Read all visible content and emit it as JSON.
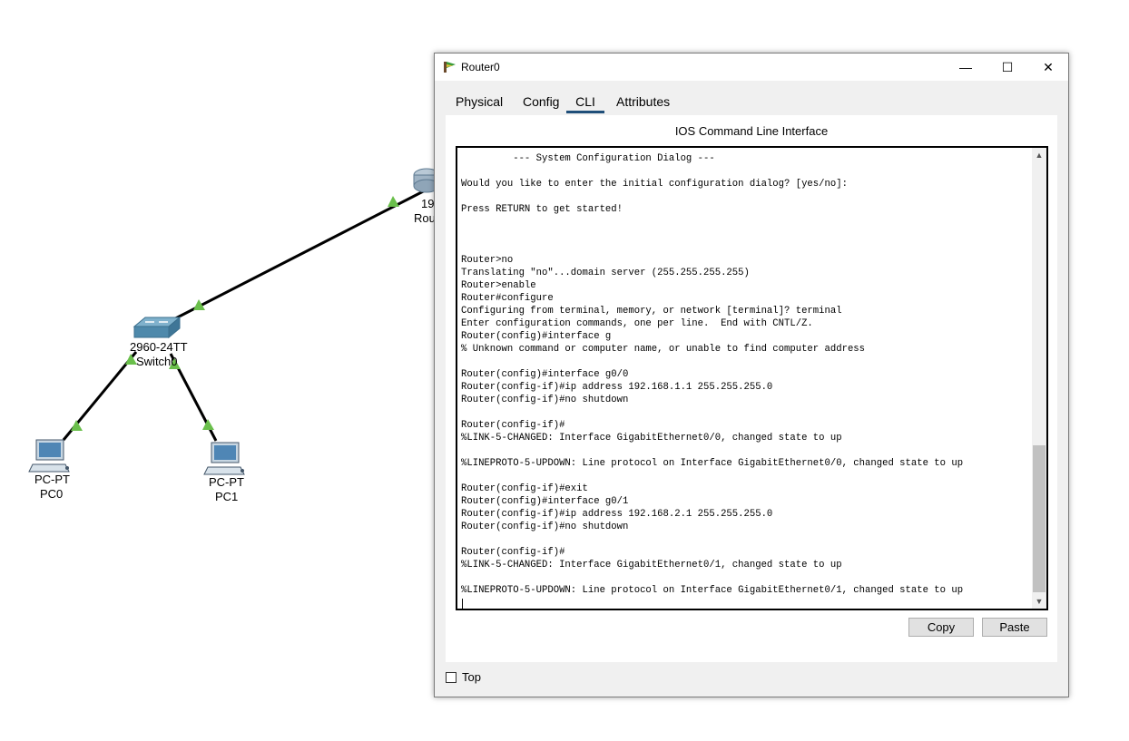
{
  "topology": {
    "devices": [
      {
        "id": "router0",
        "model_label": "19",
        "name_label": "Rou"
      },
      {
        "id": "switch0",
        "model_label": "2960-24TT",
        "name_label": "Switch0"
      },
      {
        "id": "pc0",
        "model_label": "PC-PT",
        "name_label": "PC0"
      },
      {
        "id": "pc1",
        "model_label": "PC-PT",
        "name_label": "PC1"
      }
    ],
    "link_status_color": "#6abf4b"
  },
  "window": {
    "title": "Router0",
    "controls": {
      "minimize": "—",
      "maximize": "☐",
      "close": "✕"
    },
    "tabs": [
      {
        "label": "Physical",
        "active": false
      },
      {
        "label": "Config",
        "active": false
      },
      {
        "label": "CLI",
        "active": true
      },
      {
        "label": "Attributes",
        "active": false
      }
    ],
    "panel_title": "IOS Command Line Interface",
    "terminal_lines": [
      "         --- System Configuration Dialog ---",
      "",
      "Would you like to enter the initial configuration dialog? [yes/no]:",
      "",
      "Press RETURN to get started!",
      "",
      "",
      "",
      "Router>no",
      "Translating \"no\"...domain server (255.255.255.255)",
      "Router>enable",
      "Router#configure",
      "Configuring from terminal, memory, or network [terminal]? terminal",
      "Enter configuration commands, one per line.  End with CNTL/Z.",
      "Router(config)#interface g",
      "% Unknown command or computer name, or unable to find computer address",
      "",
      "Router(config)#interface g0/0",
      "Router(config-if)#ip address 192.168.1.1 255.255.255.0",
      "Router(config-if)#no shutdown",
      "",
      "Router(config-if)#",
      "%LINK-5-CHANGED: Interface GigabitEthernet0/0, changed state to up",
      "",
      "%LINEPROTO-5-UPDOWN: Line protocol on Interface GigabitEthernet0/0, changed state to up",
      "",
      "Router(config-if)#exit",
      "Router(config)#interface g0/1",
      "Router(config-if)#ip address 192.168.2.1 255.255.255.0",
      "Router(config-if)#no shutdown",
      "",
      "Router(config-if)#",
      "%LINK-5-CHANGED: Interface GigabitEthernet0/1, changed state to up",
      "",
      "%LINEPROTO-5-UPDOWN: Line protocol on Interface GigabitEthernet0/1, changed state to up",
      ""
    ],
    "scroll_up_icon": "▲",
    "scroll_down_icon": "▼",
    "copy_label": "Copy",
    "paste_label": "Paste",
    "top_label": "Top",
    "top_checked": false
  }
}
